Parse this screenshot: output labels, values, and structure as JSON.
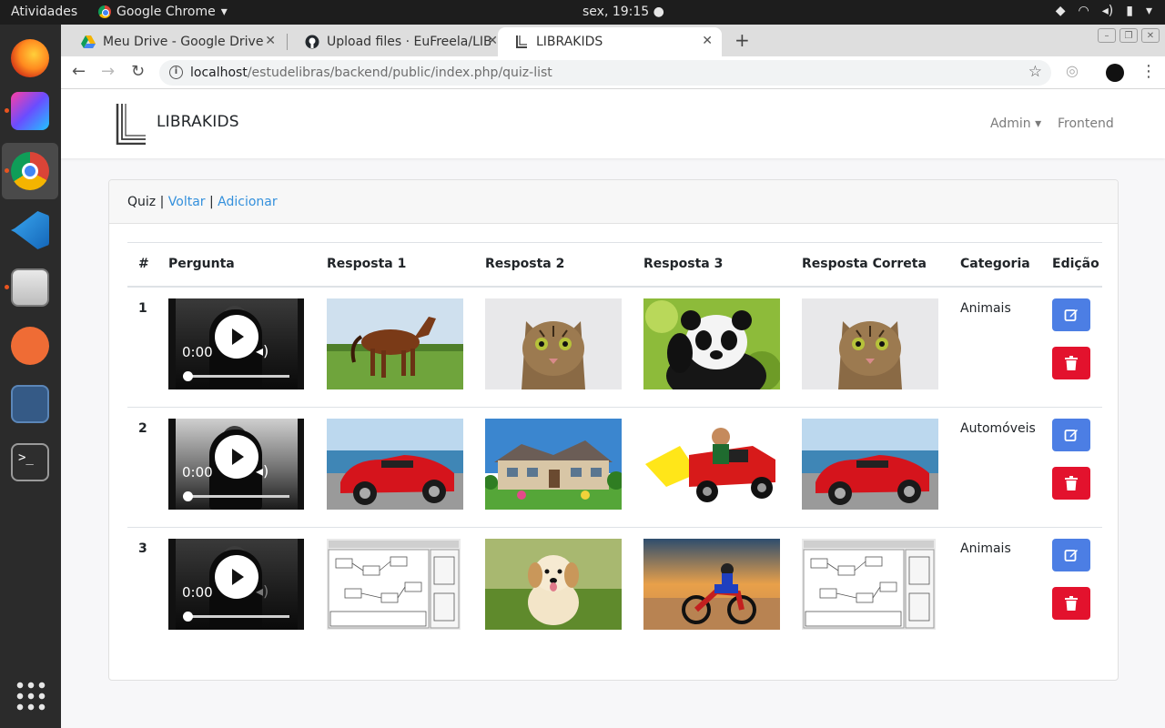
{
  "os": {
    "activities": "Atividades",
    "app_name": "Google Chrome",
    "clock": "sex, 19:15 ●"
  },
  "browser": {
    "tabs": [
      {
        "title": "Meu Drive - Google Drive"
      },
      {
        "title": "Upload files · EuFreela/LIB"
      },
      {
        "title": "LIBRAKIDS"
      }
    ],
    "url_host": "localhost",
    "url_path": "/estudelibras/backend/public/index.php/quiz-list"
  },
  "navbar": {
    "brand": "LIBRAKIDS",
    "admin": "Admin ▾",
    "frontend": "Frontend"
  },
  "card": {
    "title": "Quiz",
    "sep1": " | ",
    "back": "Voltar",
    "sep2": " | ",
    "add": "Adicionar"
  },
  "table": {
    "headers": [
      "#",
      "Pergunta",
      "Resposta 1",
      "Resposta 2",
      "Resposta 3",
      "Resposta Correta",
      "Categoria",
      "Edição"
    ],
    "rows": [
      {
        "id": "1",
        "video_time": "0:00",
        "resposta1": "horse",
        "resposta2": "cat",
        "resposta3": "panda",
        "correta": "cat",
        "categoria": "Animais"
      },
      {
        "id": "2",
        "video_time": "0:00",
        "resposta1": "red-car",
        "resposta2": "house",
        "resposta3": "toy-truck",
        "correta": "red-car",
        "categoria": "Automóveis"
      },
      {
        "id": "3",
        "video_time": "0:00",
        "resposta1": "software-screenshot",
        "resposta2": "puppy",
        "resposta3": "motorbike",
        "correta": "software-screenshot",
        "categoria": "Animais"
      }
    ]
  },
  "colors": {
    "link": "#3490dc",
    "edit": "#4c7ee4",
    "delete": "#e3122d"
  }
}
